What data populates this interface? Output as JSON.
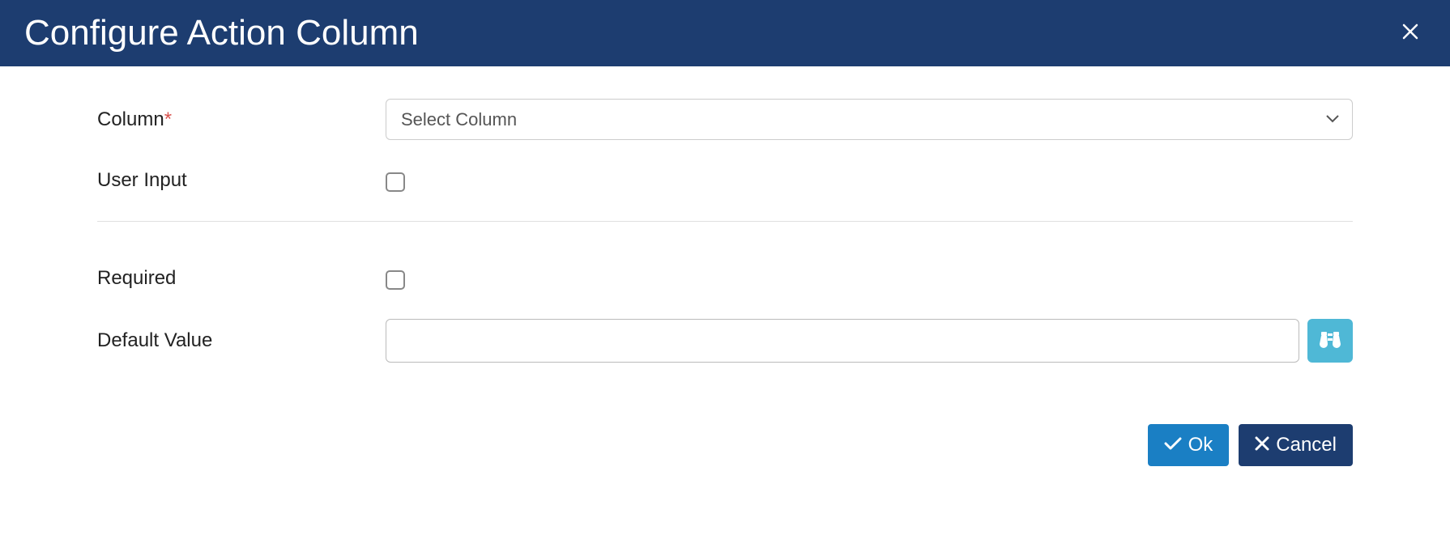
{
  "header": {
    "title": "Configure Action Column"
  },
  "form": {
    "column": {
      "label": "Column",
      "required_marker": "*",
      "selected": "Select Column"
    },
    "user_input": {
      "label": "User Input",
      "checked": false
    },
    "required": {
      "label": "Required",
      "checked": false
    },
    "default_value": {
      "label": "Default Value",
      "value": ""
    }
  },
  "footer": {
    "ok_label": "Ok",
    "cancel_label": "Cancel"
  }
}
